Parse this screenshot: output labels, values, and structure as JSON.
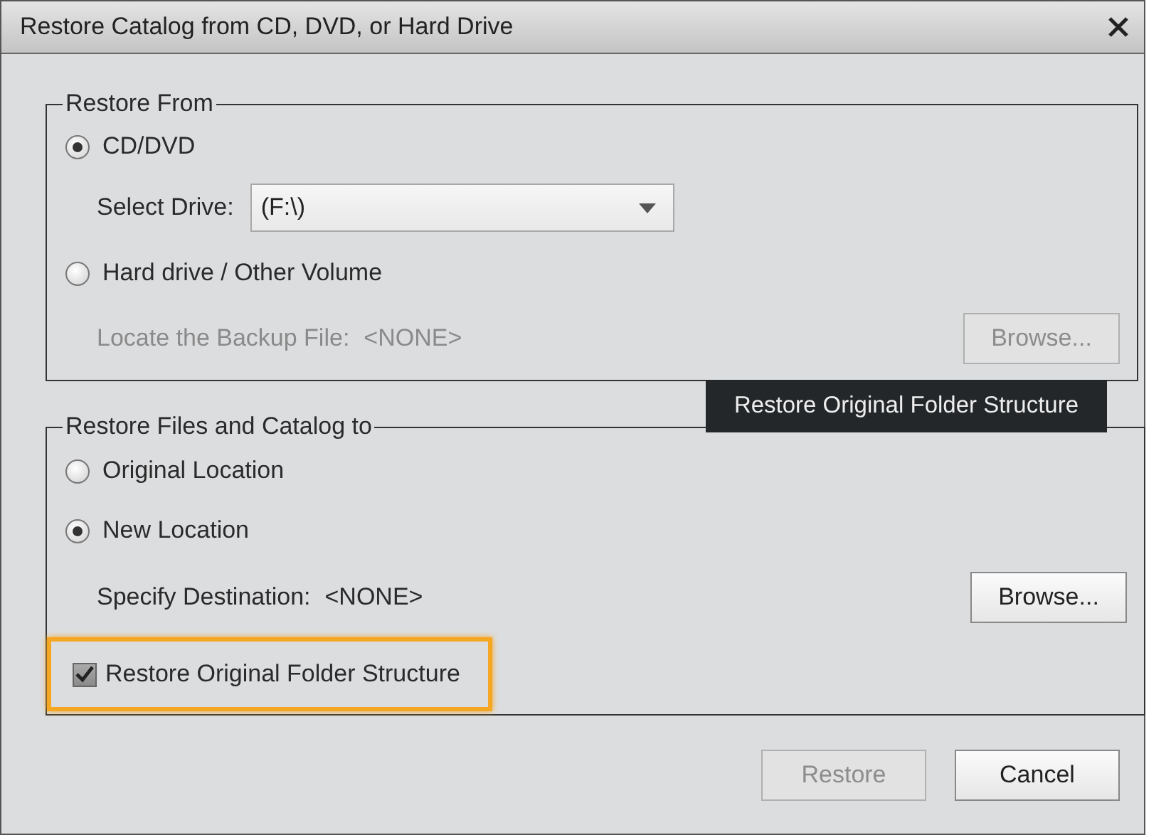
{
  "window": {
    "title": "Restore Catalog from CD, DVD, or Hard Drive"
  },
  "restore_from": {
    "legend": "Restore From",
    "options": [
      {
        "label": "CD/DVD",
        "selected": true
      },
      {
        "label": "Hard drive / Other Volume",
        "selected": false
      }
    ],
    "drive": {
      "label": "Select Drive:",
      "value": "(F:\\)"
    },
    "backup_file": {
      "label": "Locate the Backup File:",
      "value": "<NONE>",
      "disabled": true
    },
    "browse": {
      "label": "Browse...",
      "disabled": true
    }
  },
  "restore_to": {
    "legend": "Restore Files and Catalog to",
    "options": [
      {
        "label": "Original Location",
        "selected": false
      },
      {
        "label": "New Location",
        "selected": true
      }
    ],
    "destination": {
      "label": "Specify Destination:",
      "value": "<NONE>",
      "disabled": false
    },
    "browse": {
      "label": "Browse...",
      "disabled": false
    },
    "folder_structure": {
      "label": "Restore Original Folder Structure",
      "checked": true,
      "highlighted": true
    }
  },
  "tooltip": "Restore Original Folder Structure",
  "buttons": [
    {
      "label": "Restore",
      "disabled": true
    },
    {
      "label": "Cancel",
      "disabled": false
    }
  ]
}
